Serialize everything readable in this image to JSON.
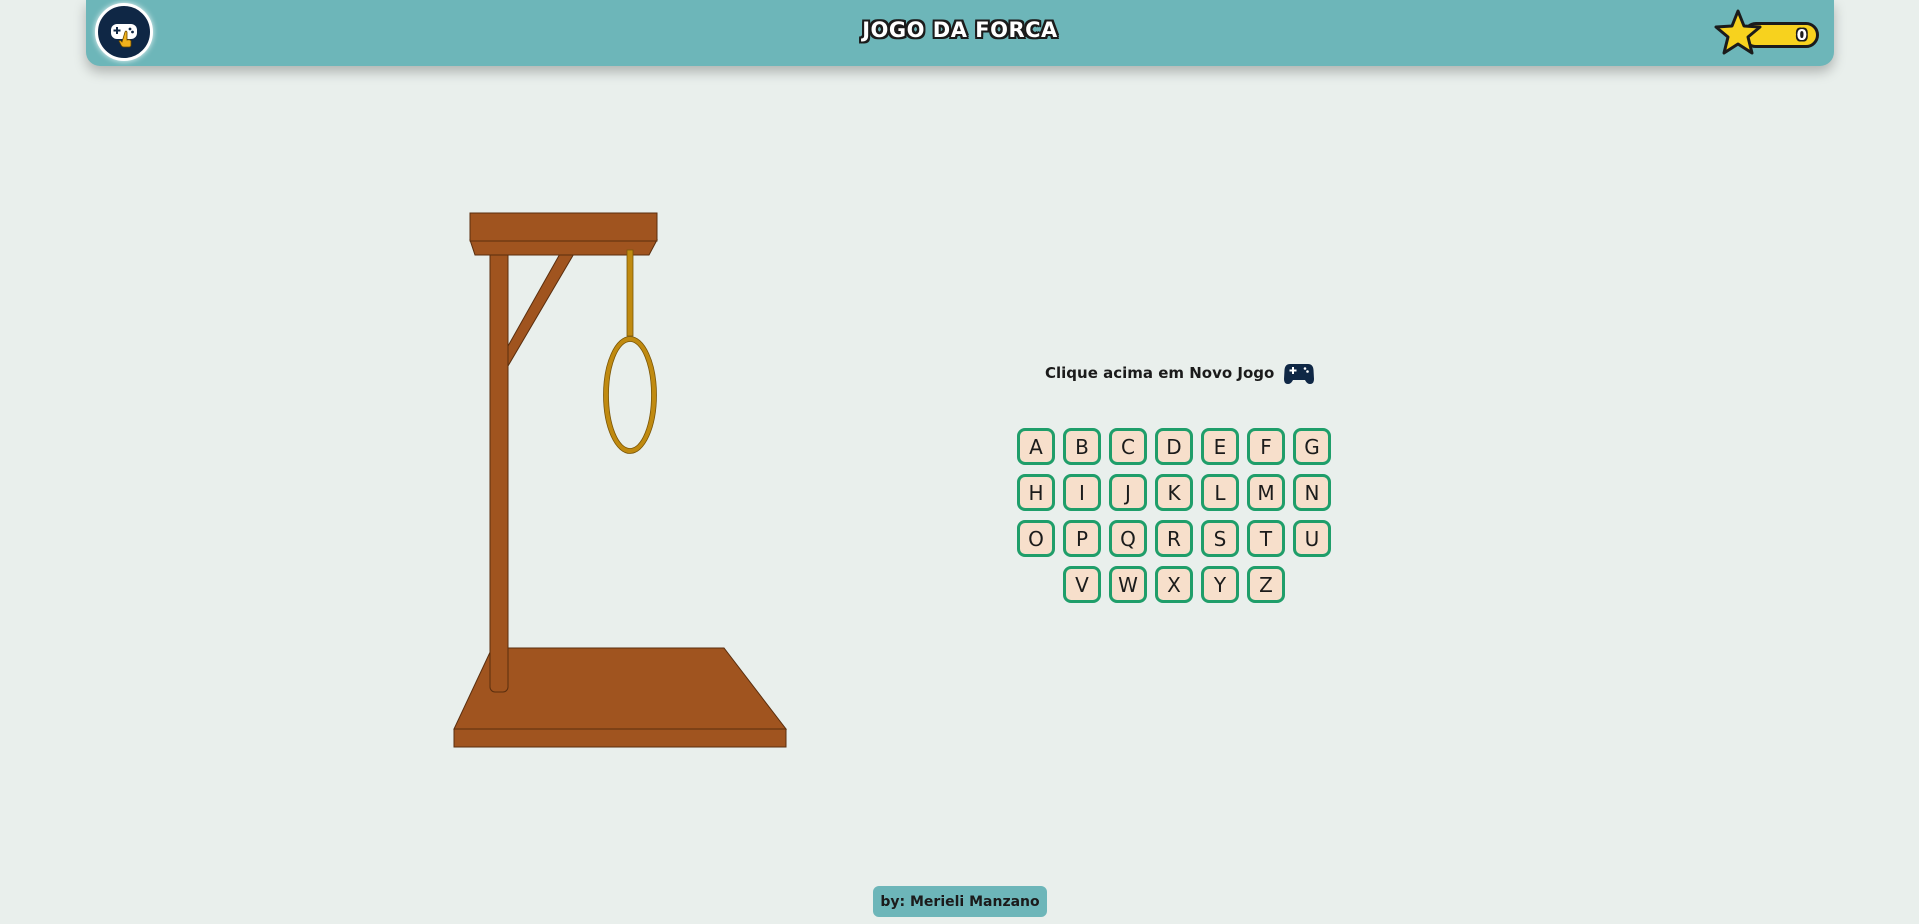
{
  "header": {
    "title": "JOGO DA FORCA",
    "new_game_icon": "gamepad-icon",
    "score_icon": "star-icon",
    "score": "0"
  },
  "gallows": {
    "description_icon": "gallows-icon"
  },
  "panel": {
    "hint_text": "Clique acima em Novo Jogo",
    "hint_icon": "gamepad-icon",
    "keyboard_rows": [
      [
        "A",
        "B",
        "C",
        "D",
        "E",
        "F",
        "G"
      ],
      [
        "H",
        "I",
        "J",
        "K",
        "L",
        "M",
        "N"
      ],
      [
        "O",
        "P",
        "Q",
        "R",
        "S",
        "T",
        "U"
      ],
      [
        "V",
        "W",
        "X",
        "Y",
        "Z"
      ]
    ]
  },
  "footer": {
    "credit": "by: Merieli Manzano"
  },
  "colors": {
    "header_bg": "#6db6b9",
    "page_bg": "#e9efec",
    "key_border": "#1f9e6a",
    "key_bg": "#f7dfcb",
    "wood": "#a0541f",
    "rope": "#c08a10",
    "star": "#f7d21e"
  }
}
